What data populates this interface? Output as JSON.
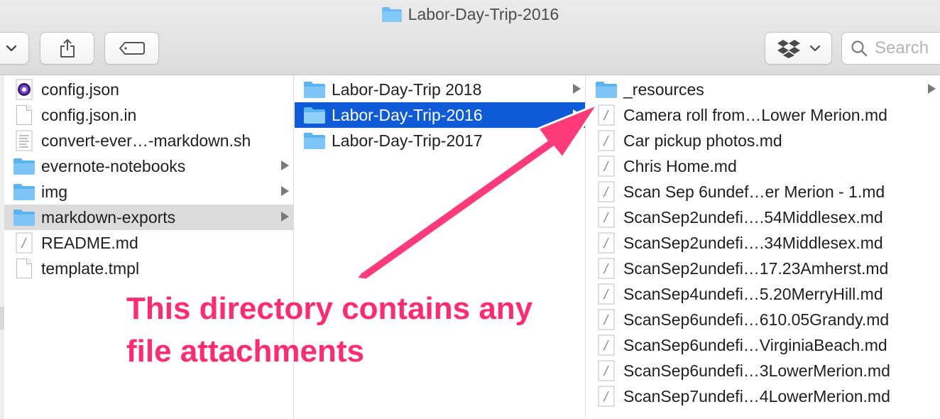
{
  "window": {
    "title": "Labor-Day-Trip-2016"
  },
  "toolbar": {
    "search_placeholder": "Search"
  },
  "column1": {
    "items": [
      {
        "label": "config.json",
        "icon": "config-json-icon",
        "has_children": false
      },
      {
        "label": "config.json.in",
        "icon": "document-icon",
        "has_children": false
      },
      {
        "label": "convert-ever…-markdown.sh",
        "icon": "script-icon",
        "has_children": false
      },
      {
        "label": "evernote-notebooks",
        "icon": "folder-icon",
        "has_children": true
      },
      {
        "label": "img",
        "icon": "folder-icon",
        "has_children": true
      },
      {
        "label": "markdown-exports",
        "icon": "folder-icon",
        "has_children": true,
        "state": "highlighted"
      },
      {
        "label": "README.md",
        "icon": "markdown-icon",
        "has_children": false
      },
      {
        "label": "template.tmpl",
        "icon": "document-icon",
        "has_children": false
      }
    ]
  },
  "column2": {
    "items": [
      {
        "label": "Labor-Day-Trip 2018",
        "icon": "folder-icon",
        "has_children": true
      },
      {
        "label": "Labor-Day-Trip-2016",
        "icon": "folder-icon",
        "has_children": true,
        "state": "selected"
      },
      {
        "label": "Labor-Day-Trip-2017",
        "icon": "folder-icon",
        "has_children": false
      }
    ]
  },
  "column3": {
    "items": [
      {
        "label": "_resources",
        "icon": "folder-icon",
        "has_children": true
      },
      {
        "label": "Camera roll from…Lower Merion.md",
        "icon": "markdown-icon"
      },
      {
        "label": "Car pickup photos.md",
        "icon": "markdown-icon"
      },
      {
        "label": "Chris Home.md",
        "icon": "markdown-icon"
      },
      {
        "label": "Scan Sep 6undef…er Merion - 1.md",
        "icon": "markdown-icon"
      },
      {
        "label": "ScanSep2undefi….54Middlesex.md",
        "icon": "markdown-icon"
      },
      {
        "label": "ScanSep2undefi….34Middlesex.md",
        "icon": "markdown-icon"
      },
      {
        "label": "ScanSep2undefi…17.23Amherst.md",
        "icon": "markdown-icon"
      },
      {
        "label": "ScanSep4undefi…5.20MerryHill.md",
        "icon": "markdown-icon"
      },
      {
        "label": "ScanSep6undefi…610.05Grandy.md",
        "icon": "markdown-icon"
      },
      {
        "label": "ScanSep6undefi…VirginiaBeach.md",
        "icon": "markdown-icon"
      },
      {
        "label": "ScanSep6undefi…3LowerMerion.md",
        "icon": "markdown-icon"
      },
      {
        "label": "ScanSep7undefi…4LowerMerion.md",
        "icon": "markdown-icon"
      }
    ]
  },
  "annotation": {
    "text": "This directory contains any\nfile attachments",
    "color": "#ff2b6e"
  },
  "colors": {
    "selection": "#0f5bd7",
    "folder": "#5ab4f0",
    "highlight_row": "#dcdcdc"
  }
}
